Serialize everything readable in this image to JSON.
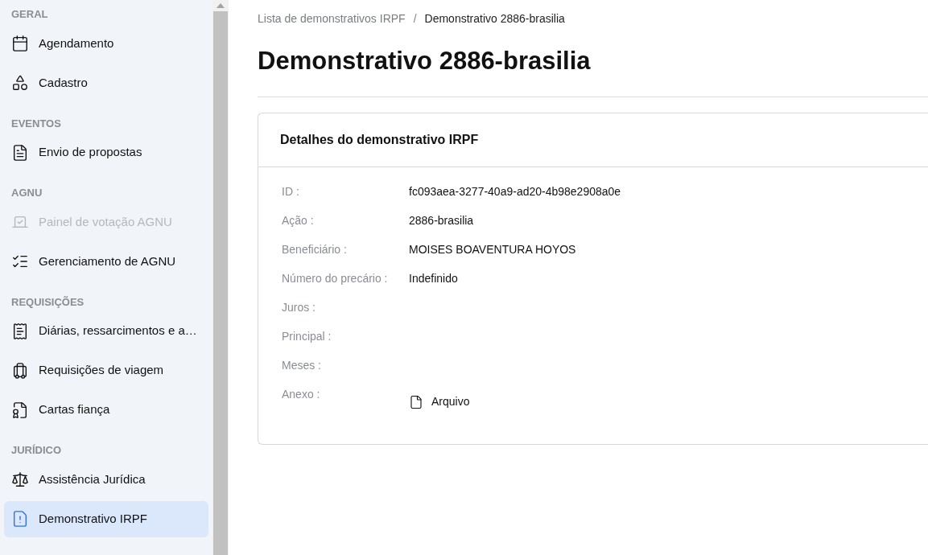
{
  "sidebar": {
    "sections": [
      {
        "title": "GERAL",
        "items": [
          {
            "label": "Agendamento",
            "selected": false,
            "disabled": false
          },
          {
            "label": "Cadastro",
            "selected": false,
            "disabled": false
          }
        ]
      },
      {
        "title": "EVENTOS",
        "items": [
          {
            "label": "Envio de propostas",
            "selected": false,
            "disabled": false
          }
        ]
      },
      {
        "title": "AGNU",
        "items": [
          {
            "label": "Painel de votação AGNU",
            "selected": false,
            "disabled": true
          },
          {
            "label": "Gerenciamento de AGNU",
            "selected": false,
            "disabled": false
          }
        ]
      },
      {
        "title": "REQUISIÇÕES",
        "items": [
          {
            "label": "Diárias, ressarcimentos e a…",
            "selected": false,
            "disabled": false
          },
          {
            "label": "Requisições de viagem",
            "selected": false,
            "disabled": false
          },
          {
            "label": "Cartas fiança",
            "selected": false,
            "disabled": false
          }
        ]
      },
      {
        "title": "JURÍDICO",
        "items": [
          {
            "label": "Assistência Jurídica",
            "selected": false,
            "disabled": false
          },
          {
            "label": "Demonstrativo IRPF",
            "selected": true,
            "disabled": false
          }
        ]
      }
    ]
  },
  "breadcrumb": {
    "items": [
      "Lista de demonstrativos IRPF",
      "Demonstrativo 2886-brasilia"
    ],
    "separator": "/"
  },
  "page_title": "Demonstrativo 2886-brasilia",
  "card": {
    "title": "Detalhes do demonstrativo IRPF",
    "fields": [
      {
        "kind": "text",
        "label": "ID :",
        "value": "fc093aea-3277-40a9-ad20-4b98e2908a0e"
      },
      {
        "kind": "text",
        "label": "Ação :",
        "value": "2886-brasilia"
      },
      {
        "kind": "text",
        "label": "Beneficiário :",
        "value": "MOISES BOAVENTURA HOYOS"
      },
      {
        "kind": "text",
        "label": "Número do precário :",
        "value": "Indefinido"
      },
      {
        "kind": "text",
        "label": "Juros :"
      },
      {
        "kind": "text",
        "label": "Principal :"
      },
      {
        "kind": "text",
        "label": "Meses :"
      },
      {
        "kind": "file",
        "label": "Anexo :",
        "value": "Arquivo"
      }
    ]
  }
}
